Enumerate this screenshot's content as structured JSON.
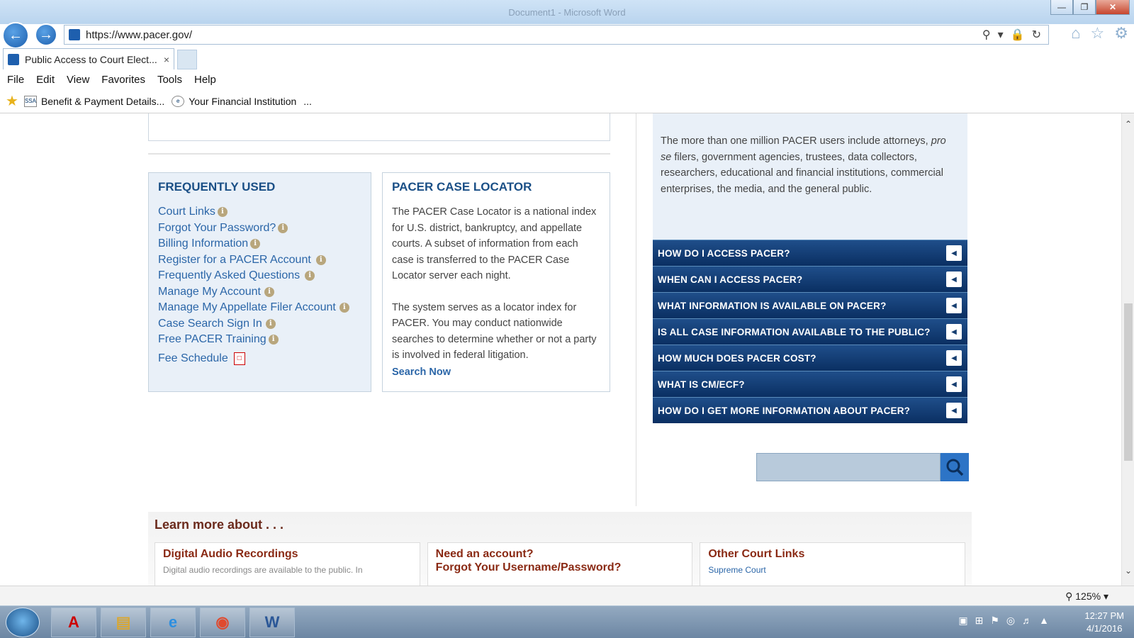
{
  "window": {
    "title": "Document1 - Microsoft Word"
  },
  "browser": {
    "url": "https://www.pacer.gov/",
    "tab_title": "Public Access to Court Elect...",
    "tab_close": "×",
    "menu": [
      "File",
      "Edit",
      "View",
      "Favorites",
      "Tools",
      "Help"
    ],
    "favorites": [
      {
        "label": "Benefit & Payment Details..."
      },
      {
        "label": "Your Financial Institution"
      }
    ],
    "favorites_more": "..."
  },
  "frequently_used": {
    "title": "FREQUENTLY USED",
    "links": [
      "Court Links",
      "Forgot Your Password?",
      "Billing Information",
      "Register for a PACER Account",
      "Frequently Asked Questions",
      "Manage My Account",
      "Manage My Appellate Filer Account",
      "Case Search Sign In",
      "Free PACER Training"
    ],
    "fee_schedule": "Fee Schedule"
  },
  "pacer_case_locator": {
    "title": "PACER CASE LOCATOR",
    "para1": "The PACER Case Locator is a national index for U.S. district, bankruptcy, and appellate courts. A subset of information from each case is transferred to the PACER Case Locator server each night.",
    "para2": "The system serves as a locator index for PACER. You may conduct nationwide searches to determine whether or not a party is involved in federal litigation.",
    "search_now": "Search Now"
  },
  "info_panel": {
    "text_before": "The more than one million PACER users include attorneys, ",
    "text_italic": "pro se",
    "text_after": " filers, government agencies, trustees, data collectors, researchers, educational and financial institutions, commercial enterprises, the media, and the general public."
  },
  "faq": [
    "HOW DO I ACCESS PACER?",
    "WHEN CAN I ACCESS PACER?",
    "WHAT INFORMATION IS AVAILABLE ON PACER?",
    "IS ALL CASE INFORMATION AVAILABLE TO THE PUBLIC?",
    "HOW MUCH DOES PACER COST?",
    "WHAT IS CM/ECF?",
    "HOW DO I GET MORE INFORMATION ABOUT PACER?"
  ],
  "search": {
    "value": ""
  },
  "learn_more": {
    "title": "Learn more about . . .",
    "cards": [
      {
        "title": "Digital Audio Recordings",
        "sub": "Digital audio recordings are available to the public. In"
      },
      {
        "title": "Need an account?\nForgot Your Username/Password?",
        "sub": ""
      },
      {
        "title": "Other Court Links",
        "sub": "Supreme Court"
      }
    ]
  },
  "status": {
    "zoom": "125%"
  },
  "taskbar": {
    "time": "12:27 PM",
    "date": "4/1/2016"
  }
}
